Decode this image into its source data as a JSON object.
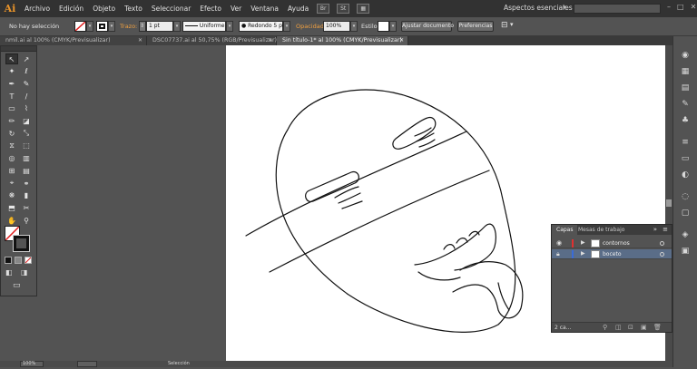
{
  "app": {
    "logo": "Ai",
    "accent_color": "#e8932a"
  },
  "menu": [
    "Archivo",
    "Edición",
    "Objeto",
    "Texto",
    "Seleccionar",
    "Efecto",
    "Ver",
    "Ventana",
    "Ayuda"
  ],
  "menubar_icons": {
    "bridge": "Br",
    "stock": "St",
    "arrange": "▦"
  },
  "workspace": {
    "label": "Aspectos esenciales",
    "search_placeholder": ""
  },
  "window_controls": {
    "minimize": "–",
    "maximize": "□",
    "close": "✕"
  },
  "control_bar": {
    "selection_status": "No hay selección",
    "stroke_label": "Trazo:",
    "stroke_value": "1 pt",
    "profile": "Uniforme",
    "brush": "● Redondo 5 pt.",
    "opacity_label": "Opacidad:",
    "opacity_value": "100%",
    "style_label": "Estilo:",
    "adjust_button": "Ajustar documento",
    "prefs_button": "Preferencias"
  },
  "tabs": [
    {
      "label": "nmil.ai al 100% (CMYK/Previsualizar)",
      "close": "✕",
      "active": false
    },
    {
      "label": "DSC07737.ai al 50,75% (RGB/Previsualizar)",
      "close": "✕",
      "active": false
    },
    {
      "label": "Sin título-1* al 100% (CMYK/Previsualizar)",
      "close": "✕",
      "active": true
    }
  ],
  "tools": [
    {
      "name": "selection-tool",
      "glyph": "↖"
    },
    {
      "name": "direct-selection-tool",
      "glyph": "↗"
    },
    {
      "name": "magic-wand-tool",
      "glyph": "✦"
    },
    {
      "name": "lasso-tool",
      "glyph": "ℓ"
    },
    {
      "name": "pen-tool",
      "glyph": "✒"
    },
    {
      "name": "curvature-tool",
      "glyph": "✎"
    },
    {
      "name": "type-tool",
      "glyph": "T"
    },
    {
      "name": "line-tool",
      "glyph": "/"
    },
    {
      "name": "rectangle-tool",
      "glyph": "▭"
    },
    {
      "name": "paintbrush-tool",
      "glyph": "⌇"
    },
    {
      "name": "pencil-tool",
      "glyph": "✏"
    },
    {
      "name": "eraser-tool",
      "glyph": "◪"
    },
    {
      "name": "rotate-tool",
      "glyph": "↻"
    },
    {
      "name": "scale-tool",
      "glyph": "⤡"
    },
    {
      "name": "width-tool",
      "glyph": "⧖"
    },
    {
      "name": "free-transform-tool",
      "glyph": "⬚"
    },
    {
      "name": "shape-builder-tool",
      "glyph": "◎"
    },
    {
      "name": "perspective-grid-tool",
      "glyph": "▥"
    },
    {
      "name": "mesh-tool",
      "glyph": "⊞"
    },
    {
      "name": "gradient-tool",
      "glyph": "▤"
    },
    {
      "name": "eyedropper-tool",
      "glyph": "⌖"
    },
    {
      "name": "blend-tool",
      "glyph": "⚭"
    },
    {
      "name": "symbol-sprayer-tool",
      "glyph": "❋"
    },
    {
      "name": "column-graph-tool",
      "glyph": "▮"
    },
    {
      "name": "artboard-tool",
      "glyph": "⬒"
    },
    {
      "name": "slice-tool",
      "glyph": "✂"
    },
    {
      "name": "hand-tool",
      "glyph": "✋"
    },
    {
      "name": "zoom-tool",
      "glyph": "⚲"
    }
  ],
  "right_panel_icons": [
    "color-icon",
    "color-guide-icon",
    "swatches-icon",
    "brushes-icon",
    "symbols-icon",
    "stroke-icon",
    "gradient-icon",
    "transparency-icon",
    "appearance-icon",
    "graphic-styles-icon",
    "layers-icon",
    "artboards-icon"
  ],
  "layers_panel": {
    "tabs": [
      "Capas",
      "Mesas de trabajo"
    ],
    "layers": [
      {
        "name": "contornos",
        "color": "#e03030",
        "visible": true,
        "locked": false,
        "selected": false
      },
      {
        "name": "boceto",
        "color": "#3a6cd8",
        "visible": false,
        "locked": true,
        "selected": true
      }
    ],
    "count": "2 ca..."
  },
  "status": {
    "zoom": "100%",
    "tool": "Selección"
  }
}
